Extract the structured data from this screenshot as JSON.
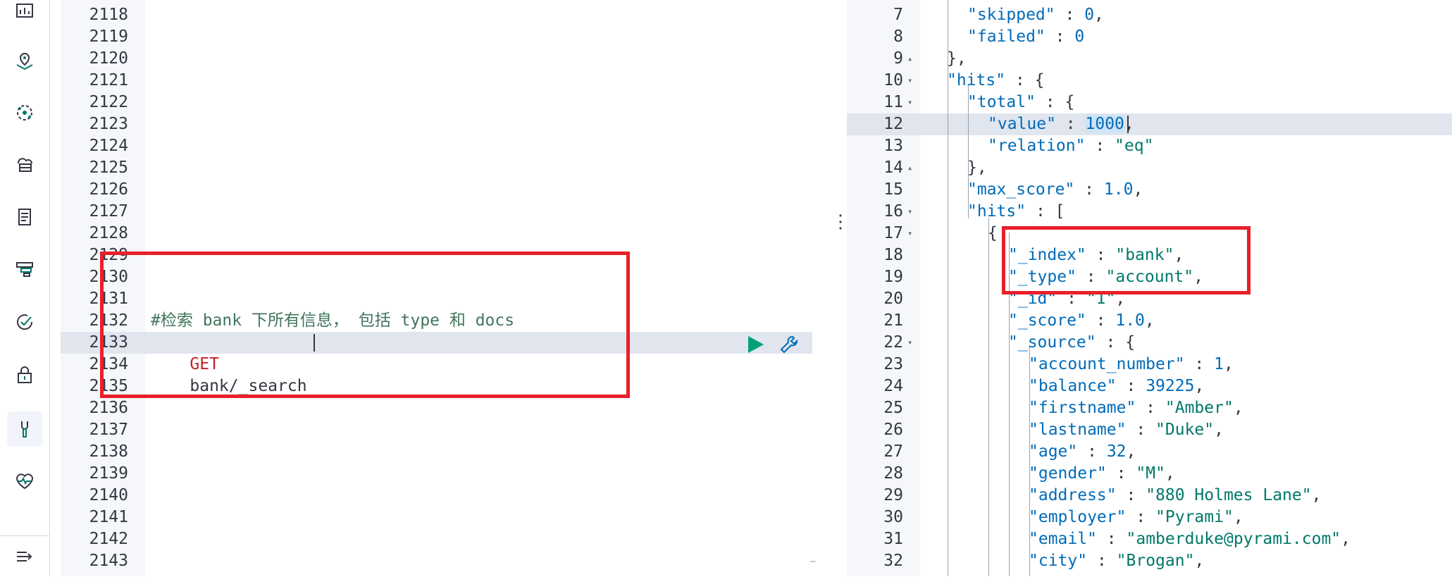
{
  "sidebar": {
    "icons": [
      {
        "name": "dashboard-icon"
      },
      {
        "name": "maps-icon"
      },
      {
        "name": "ml-icon"
      },
      {
        "name": "infrastructure-icon"
      },
      {
        "name": "logs-icon"
      },
      {
        "name": "apm-icon"
      },
      {
        "name": "uptime-icon"
      },
      {
        "name": "siem-icon"
      },
      {
        "name": "dev-tools-icon"
      },
      {
        "name": "monitoring-icon"
      }
    ],
    "active": "dev-tools-icon"
  },
  "request_editor": {
    "line_numbers": [
      "2118",
      "2119",
      "2120",
      "2121",
      "2122",
      "2123",
      "2124",
      "2125",
      "2126",
      "2127",
      "2128",
      "2129",
      "2130",
      "2131",
      "2132",
      "2133",
      "2134",
      "2135",
      "2136",
      "2137",
      "2138",
      "2139",
      "2140",
      "2141",
      "2142",
      "2143"
    ],
    "comment": "#检索 bank 下所有信息， 包括 type 和 docs",
    "method": "GET",
    "path": "bank/_search",
    "active_line": "2133"
  },
  "response_viewer": {
    "lines": [
      {
        "no": "7",
        "fold": "",
        "text": "\"skipped\" : 0,"
      },
      {
        "no": "8",
        "fold": "",
        "text": "\"failed\" : 0"
      },
      {
        "no": "9",
        "fold": "▴",
        "text": "},"
      },
      {
        "no": "10",
        "fold": "▾",
        "text": "\"hits\" : {"
      },
      {
        "no": "11",
        "fold": "▾",
        "text": "\"total\" : {"
      },
      {
        "no": "12",
        "fold": "",
        "text": "\"value\" : 1000,"
      },
      {
        "no": "13",
        "fold": "",
        "text": "\"relation\" : \"eq\""
      },
      {
        "no": "14",
        "fold": "▴",
        "text": "},"
      },
      {
        "no": "15",
        "fold": "",
        "text": "\"max_score\" : 1.0,"
      },
      {
        "no": "16",
        "fold": "▾",
        "text": "\"hits\" : ["
      },
      {
        "no": "17",
        "fold": "▾",
        "text": "{"
      },
      {
        "no": "18",
        "fold": "",
        "text": "\"_index\" : \"bank\","
      },
      {
        "no": "19",
        "fold": "",
        "text": "\"_type\" : \"account\","
      },
      {
        "no": "20",
        "fold": "",
        "text": "\"_id\" : \"1\","
      },
      {
        "no": "21",
        "fold": "",
        "text": "\"_score\" : 1.0,"
      },
      {
        "no": "22",
        "fold": "▾",
        "text": "\"_source\" : {"
      },
      {
        "no": "23",
        "fold": "",
        "text": "\"account_number\" : 1,"
      },
      {
        "no": "24",
        "fold": "",
        "text": "\"balance\" : 39225,"
      },
      {
        "no": "25",
        "fold": "",
        "text": "\"firstname\" : \"Amber\","
      },
      {
        "no": "26",
        "fold": "",
        "text": "\"lastname\" : \"Duke\","
      },
      {
        "no": "27",
        "fold": "",
        "text": "\"age\" : 32,"
      },
      {
        "no": "28",
        "fold": "",
        "text": "\"gender\" : \"M\","
      },
      {
        "no": "29",
        "fold": "",
        "text": "\"address\" : \"880 Holmes Lane\","
      },
      {
        "no": "30",
        "fold": "",
        "text": "\"employer\" : \"Pyrami\","
      },
      {
        "no": "31",
        "fold": "",
        "text": "\"email\" : \"amberduke@pyrami.com\","
      },
      {
        "no": "32",
        "fold": "",
        "text": "\"city\" : \"Brogan\","
      }
    ],
    "active_line": "12"
  },
  "colors": {
    "annotation": "#e8202a",
    "key": "#006bb8",
    "string": "#00786a",
    "method": "#c61e25",
    "comment": "#41755c",
    "run_button": "#00a07a"
  }
}
